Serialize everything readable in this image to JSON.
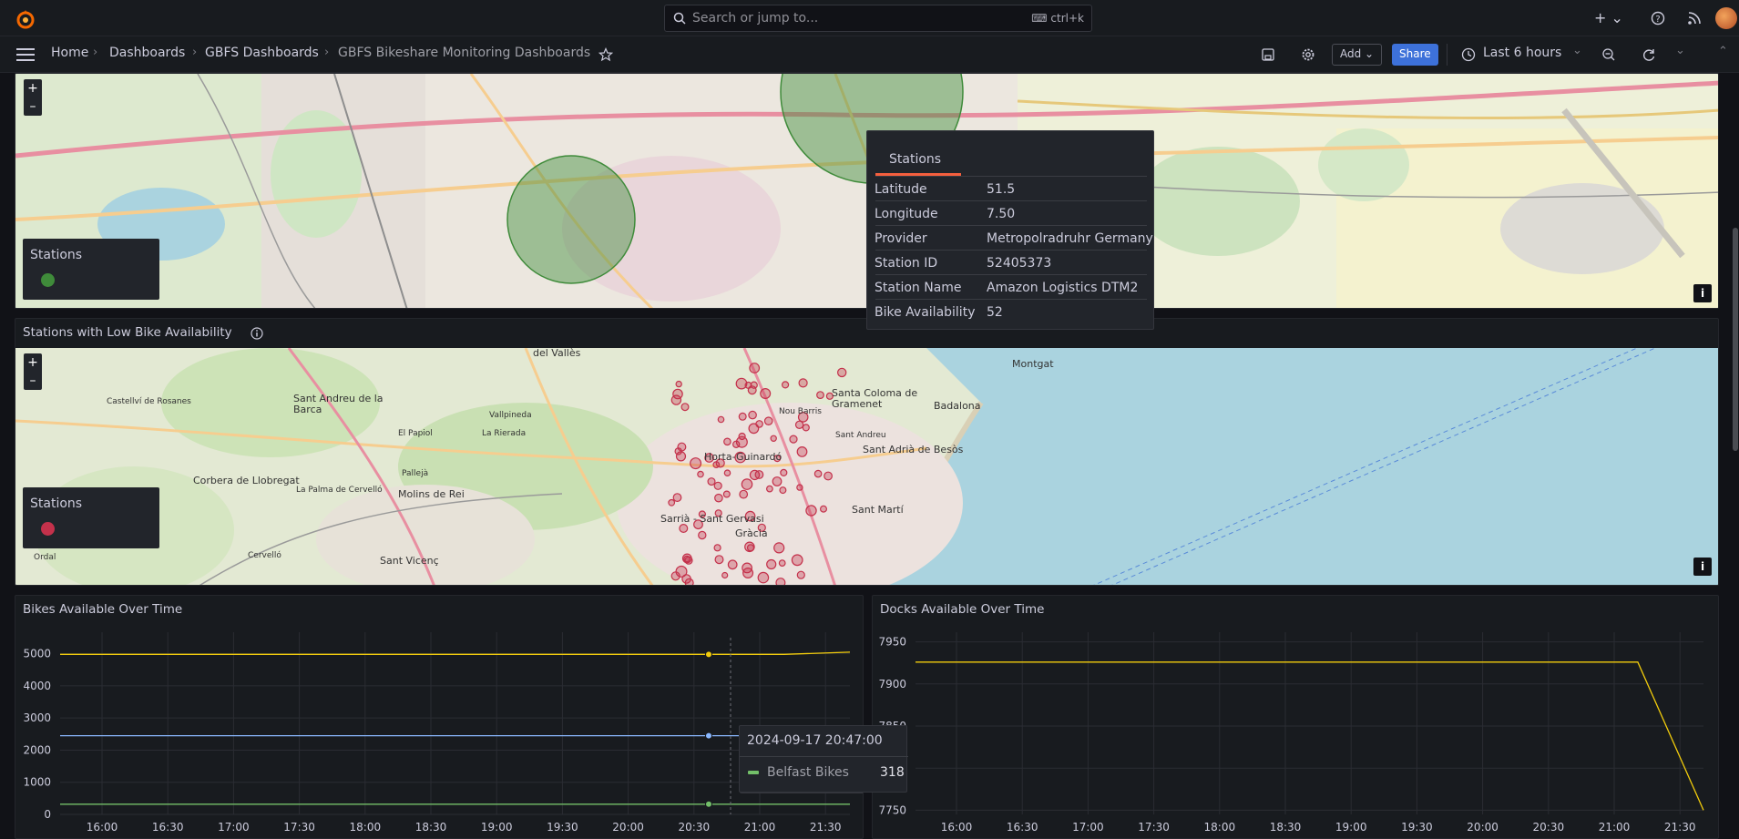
{
  "search": {
    "placeholder": "Search or jump to...",
    "shortcut": "ctrl+k"
  },
  "breadcrumb": {
    "home": "Home",
    "dashboards": "Dashboards",
    "folder": "GBFS Dashboards",
    "current": "GBFS Bikeshare Monitoring Dashboards"
  },
  "toolbar": {
    "add_label": "Add",
    "share_label": "Share",
    "time_range": "Last 6 hours"
  },
  "map_top": {
    "legend_title": "Stations",
    "legend_color": "#3f8b3a",
    "tooltip": {
      "tab": "Stations",
      "rows": [
        {
          "key": "Latitude",
          "value": "51.5"
        },
        {
          "key": "Longitude",
          "value": "7.50"
        },
        {
          "key": "Provider",
          "value": "Metropolradruhr Germany"
        },
        {
          "key": "Station ID",
          "value": "52405373"
        },
        {
          "key": "Station Name",
          "value": "Amazon Logistics DTM2"
        },
        {
          "key": "Bike Availability",
          "value": "52"
        }
      ]
    }
  },
  "map_low": {
    "title": "Stations with Low Bike Availability",
    "legend_title": "Stations",
    "legend_color": "#c4314b",
    "places": [
      "del Vallès",
      "Montgat",
      "Santa Coloma de Gramenet",
      "Badalona",
      "Sant Andreu de la Barca",
      "Castellví de Rosanes",
      "El Papiol",
      "La Rierada",
      "Vallpineda",
      "Nou Barris",
      "Sant Andreu",
      "Horta-Guinardó",
      "Sant Adrià de Besòs",
      "Corbera de Llobregat",
      "Pallejà",
      "Molins de Rei",
      "La Palma de Cervelló",
      "Sarrià - Sant Gervasi",
      "Gràcia",
      "Sant Martí",
      "Cervelló",
      "Sant Vicenç",
      "Ordal"
    ]
  },
  "bikes_chart": {
    "title": "Bikes Available Over Time",
    "tooltip_time": "2024-09-17 20:47:00",
    "tooltip_series": "Belfast Bikes",
    "tooltip_value": "318"
  },
  "docks_chart": {
    "title": "Docks Available Over Time"
  },
  "chart_data": [
    {
      "type": "line",
      "title": "Bikes Available Over Time",
      "x": [
        "16:00",
        "16:30",
        "17:00",
        "17:30",
        "18:00",
        "18:30",
        "19:00",
        "19:30",
        "20:00",
        "20:30",
        "21:00",
        "21:30"
      ],
      "yticks": [
        "0",
        "1000",
        "2000",
        "3000",
        "4000",
        "5000"
      ],
      "ylim": [
        0,
        5500
      ],
      "series": [
        {
          "color": "#f2cc0c",
          "values": [
            4980,
            4980,
            4980,
            4980,
            4980,
            4980,
            4980,
            4980,
            4980,
            4980,
            4980,
            4980,
            5050
          ]
        },
        {
          "color": "#8ab8ff",
          "values": [
            2450,
            2450,
            2450,
            2450,
            2450,
            2450,
            2450,
            2450,
            2450,
            2450,
            2450,
            2450,
            2450
          ]
        },
        {
          "name": "Belfast Bikes",
          "color": "#73bf69",
          "values": [
            318,
            318,
            318,
            318,
            318,
            318,
            318,
            318,
            318,
            318,
            318,
            318,
            318
          ]
        }
      ],
      "grid": true
    },
    {
      "type": "line",
      "title": "Docks Available Over Time",
      "x": [
        "16:00",
        "16:30",
        "17:00",
        "17:30",
        "18:00",
        "18:30",
        "19:00",
        "19:30",
        "20:00",
        "20:30",
        "21:00",
        "21:30"
      ],
      "yticks": [
        "7750",
        "7800",
        "7850",
        "7900",
        "7950"
      ],
      "ylim": [
        7745,
        7955
      ],
      "series": [
        {
          "color": "#f2cc0c",
          "values": [
            7926,
            7926,
            7926,
            7926,
            7926,
            7926,
            7926,
            7926,
            7926,
            7926,
            7926,
            7926,
            7750
          ]
        }
      ],
      "grid": true
    }
  ]
}
